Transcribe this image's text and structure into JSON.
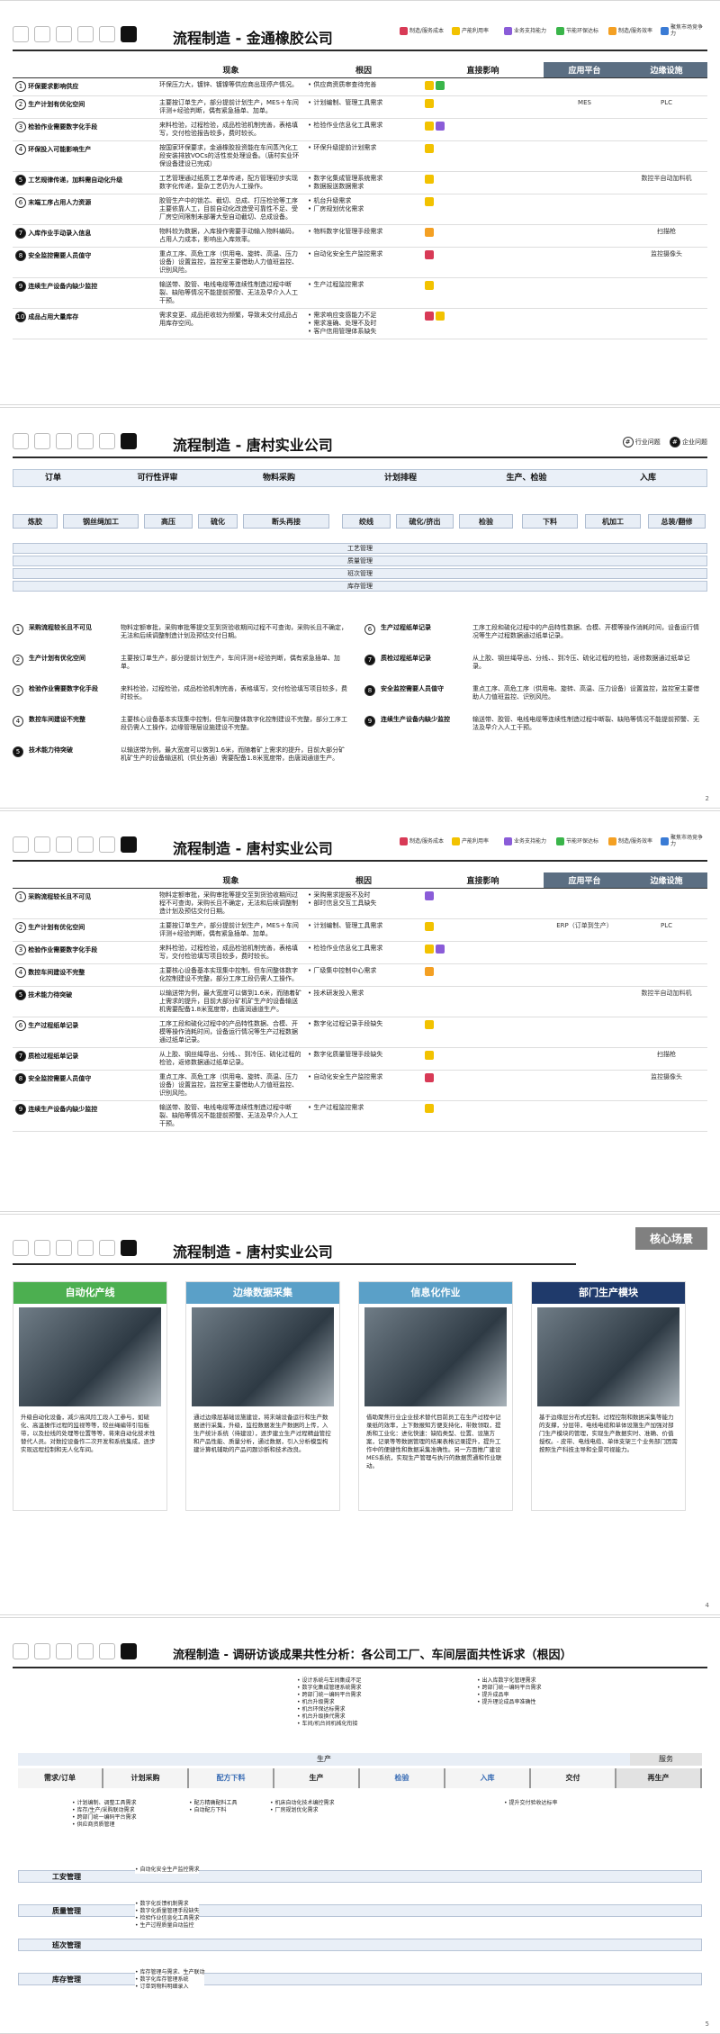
{
  "legend": [
    {
      "label": "制造/服务成本",
      "color": "#d83a56"
    },
    {
      "label": "产能利用率",
      "color": "#f2c200"
    },
    {
      "label": "业务支持能力",
      "color": "#8a5cd8"
    },
    {
      "label": "节能环保达标",
      "color": "#3ab54a"
    },
    {
      "label": "制造/服务效率",
      "color": "#f4a023"
    },
    {
      "label": "聚焦市场竞争力",
      "color": "#3a7bd5"
    }
  ],
  "slide1": {
    "title": "流程制造 - 金通橡胶公司",
    "headers": {
      "phenomenon": "现象",
      "root": "根因",
      "impact": "直接影响",
      "platform": "应用平台",
      "edge": "边缘设施"
    },
    "rows": [
      {
        "n": "1",
        "problem": "环保要求影响供应",
        "phen": "环保压力大，镀锌、镀镍等供应商出现停产情况。",
        "root": [
          "供应商资质审查待完善"
        ],
        "plat": "",
        "edge": ""
      },
      {
        "n": "2",
        "problem": "生产计划有优化空间",
        "phen": "主要按订单生产，部分提前计划生产，MES＋车间评测+经验判断，偶有紧急插单、加单。",
        "root": [
          "计划编制、管理工具需求"
        ],
        "plat": "MES",
        "edge": "PLC"
      },
      {
        "n": "3",
        "problem": "检验作业需要数字化手段",
        "phen": "来料检验，过程检验，成品检验机制完善，表格填写，交付检验报告较多，费时较长。",
        "root": [
          "检验作业信息化工具需求"
        ],
        "plat": "",
        "edge": ""
      },
      {
        "n": "4",
        "problem": "环保投入可能影响生产",
        "phen": "按国家环保要求，金通橡胶投资能在车间蒸汽化工段安装排放VOCs的活性炭处理设备。（唐村实业环保设备建设已完成）",
        "root": [
          "环保升级提前计划需求"
        ],
        "plat": "",
        "edge": ""
      },
      {
        "n": "5",
        "problem": "工艺规律传递，加料需自动化升级",
        "phen": "工艺管理通过纸质工艺单传递，配方管理初步实现数字化传递，复杂工艺仍为人工操作。",
        "root": [
          "数字化集成管理系统需求",
          "数据报送数据需求"
        ],
        "plat": "",
        "edge": "数控半自动加料机"
      },
      {
        "n": "6",
        "problem": "末端工序占用人力资源",
        "phen": "胶管生产中的锁芯、截切、总成、打压检验等工序主要依靠人工，目前自动化改造受可靠性不足、受厂房空间限制未部署大型自动截切、总成设备。",
        "root": [
          "机台升级需求",
          "厂房规划优化需求"
        ],
        "plat": "",
        "edge": ""
      },
      {
        "n": "7",
        "problem": "入库作业手动录入信息",
        "phen": "物料较为数据，入库操作需要手动输入物料编码，占用人力成本，影响出入库效率。",
        "root": [
          "物料数字化管理手段需求"
        ],
        "plat": "",
        "edge": "扫描枪"
      },
      {
        "n": "8",
        "problem": "安全监控需要人员值守",
        "phen": "重点工序、高危工序（供用电、旋转、高温、压力设备）设置监控，监控室主要借助人力值班监控、识别风险。",
        "root": [
          "自动化安全生产监控需求"
        ],
        "plat": "",
        "edge": "监控摄像头"
      },
      {
        "n": "9",
        "problem": "连续生产设备内缺少监控",
        "phen": "输送带、胶管、电线电缆等连续性制造过程中断裂、缺陷等情况不能提前预警、无法及早介入人工干预。",
        "root": [
          "生产过程监控需求"
        ],
        "plat": "",
        "edge": ""
      },
      {
        "n": "10",
        "problem": "成品占用大量库存",
        "phen": "需求变更、成品拒收较为频繁，导致未交付成品占用库存空间。",
        "root": [
          "需求响应变感能力不足",
          "需求准确、处理不及时",
          "客户信用管理体系缺失"
        ],
        "plat": "",
        "edge": ""
      }
    ]
  },
  "slide2": {
    "title": "流程制造 - 唐村实业公司",
    "tags": [
      "行业问题",
      "企业问题"
    ],
    "stages": [
      "订单",
      "可行性评审",
      "物料采购",
      "计划排程",
      "生产、检验",
      "入库"
    ],
    "substeps": [
      "炼胶",
      "钢丝绳加工",
      "高压",
      "硫化",
      "断头再接",
      "绞线",
      "硫化/挤出",
      "检验",
      "下料",
      "机加工",
      "总装/翻修"
    ],
    "lanes": [
      "工艺管理",
      "质量管理",
      "班次管理",
      "库存管理"
    ],
    "items": [
      {
        "n": "1",
        "t": "采购流程较长且不可见",
        "d": "物料定额审批，采购审批等提交至到货验收期间过程不可查询，采购长且不确定，无法和后续调整制造计划及预估交付日期。"
      },
      {
        "n": "2",
        "t": "生产计划有优化空间",
        "d": "主要按订单生产，部分提前计划生产，车间评测+经验判断，偶有紧急插单、加单。"
      },
      {
        "n": "3",
        "t": "检验作业需要数字化手段",
        "d": "来料检验，过程检验，成品检验机制完善，表格填写，交付检验填写项目较多，费时较长。"
      },
      {
        "n": "4",
        "t": "数控车间建设不完整",
        "d": "主要核心设备基本实现集中控制，但车间整体数字化控制建设不完整，部分工序工段仍需人工操作，边缘管理层设施建设不完整。"
      },
      {
        "n": "5",
        "t": "技术能力待突破",
        "d": "以输送带为例，最大宽度可以做到1.6米，而随着矿上需求的提升，目前大部分矿机矿生产的设备输送机（供业务通）需要配备1.8米宽度带，由唐润通道生产。"
      },
      {
        "n": "6",
        "t": "生产过程纸单记录",
        "d": "工序工段和硫化过程中的产品特性数据、合模、开模等操作消耗时间，设备运行情况等生产过程数据通过纸单记录。"
      },
      {
        "n": "7",
        "t": "质检过程纸单记录",
        "d": "从上胶、钢丝绳导出、分线、、到冷压、硫化过程的检验，返修数据通过纸单记录。"
      },
      {
        "n": "8",
        "t": "安全监控需要人员值守",
        "d": "重点工序、高危工序（供用电、旋转、高温、压力设备）设置监控，监控室主要借助人力值班监控、识别风险。"
      },
      {
        "n": "9",
        "t": "连续生产设备内缺少监控",
        "d": "输送带、胶管、电线电缆等连续性制造过程中断裂、缺陷等情况不能提前预警、无法及早介入人工干预。"
      }
    ],
    "page": "2"
  },
  "slide3": {
    "title": "流程制造 - 唐村实业公司",
    "headers": {
      "phenomenon": "现象",
      "root": "根因",
      "impact": "直接影响",
      "platform": "应用平台",
      "edge": "边缘设施"
    },
    "rows": [
      {
        "n": "1",
        "problem": "采购流程较长且不可见",
        "phen": "物料定额审批，采购审批等提交至到货验收期间过程不可查询，采购长且不确定，无法和后续调整制造计划及预估交付日期。",
        "root": [
          "采购需求提报不及时",
          "部时信息交互工具缺失"
        ],
        "plat": "",
        "edge": ""
      },
      {
        "n": "2",
        "problem": "生产计划有优化空间",
        "phen": "主要按订单生产，部分提前计划生产，MES＋车间评测+经验判断，偶有紧急插单、加单。",
        "root": [
          "计划编制、管理工具需求"
        ],
        "plat": "ERP（订单到生产）",
        "edge": "PLC"
      },
      {
        "n": "3",
        "problem": "检验作业需要数字化手段",
        "phen": "来料检验，过程检验，成品检验机制完善，表格填写，交付检验填写项目较多，费时较长。",
        "root": [
          "检验作业信息化工具需求"
        ],
        "plat": "",
        "edge": ""
      },
      {
        "n": "4",
        "problem": "数控车间建设不完整",
        "phen": "主要核心设备基本实现集中控制，但车间整体数字化控制建设不完整，部分工序工段仍需人工操作。",
        "root": [
          "厂级集中控制中心需求"
        ],
        "plat": "",
        "edge": ""
      },
      {
        "n": "5",
        "problem": "技术能力待突破",
        "phen": "以输送带为例，最大宽度可以做到1.6米，而随着矿上需求的提升，目前大部分矿机矿生产的设备输送机需要配备1.8米宽度带，由唐润通道生产。",
        "root": [
          "技术研发投入需求"
        ],
        "plat": "",
        "edge": "数控半自动加料机"
      },
      {
        "n": "6",
        "problem": "生产过程纸单记录",
        "phen": "工序工段和硫化过程中的产品特性数据、合模、开模等操作消耗时间，设备运行情况等生产过程数据通过纸单记录。",
        "root": [
          "数字化过程记录手段缺失"
        ],
        "plat": "",
        "edge": ""
      },
      {
        "n": "7",
        "problem": "质检过程纸单记录",
        "phen": "从上胶、钢丝绳导出、分线、、到冷压、硫化过程的检验，返修数据通过纸单记录。",
        "root": [
          "数字化质量管理手段缺失"
        ],
        "plat": "",
        "edge": "扫描枪"
      },
      {
        "n": "8",
        "problem": "安全监控需要人员值守",
        "phen": "重点工序、高危工序（供用电、旋转、高温、压力设备）设置监控，监控室主要借助人力值班监控、识别风险。",
        "root": [
          "自动化安全生产监控需求"
        ],
        "plat": "",
        "edge": "监控摄像头"
      },
      {
        "n": "9",
        "problem": "连续生产设备内缺少监控",
        "phen": "输送带、胶管、电线电缆等连续性制造过程中断裂、缺陷等情况不能提前预警、无法及早介入人工干预。",
        "root": [
          "生产过程监控需求"
        ],
        "plat": "",
        "edge": ""
      }
    ]
  },
  "slide4": {
    "title": "流程制造 - 唐村实业公司",
    "core": "核心场景",
    "cards": [
      {
        "title": "自动化产线",
        "color": "#4caf50",
        "text": "升级自动化设备，减少高风险工段人工参与，如硫化、高温操作过程的监视等等，较丝绳编带引铅板带，以及拉线的处理等位置等等，将来自动化技术性替代人员。对数控设备作二次开发和系统集成，逐步实现远程控制和无人化车间。"
      },
      {
        "title": "边缘数据采集",
        "color": "#5aa0c8",
        "text": "通过边缘层基础设施建设，将末端设备运行和生产数据进行采集，升级，监控数据发生产数据的上传，入生产统计系统（待建设），逐步建立生产过程精益管控和产品性能、质量分析，通过数据，引入分析模型构建计算机辅助的产品问题诊断和技术改良。"
      },
      {
        "title": "信息化作业",
        "color": "#5aa0c8",
        "text": "借助聚焦行业企业技术替代目前员工在生产过程中记录纸的效率，上下数报知方便支持化，带数领取，提质和工业化：进化快速：缺陷类型、位置、设施方案，记录等等数据管理的结果表格记录提升，提升工作中的便捷性和数据采集准确性。另一方面推广建设MES系统，实现生产管理与执行的数据贯通和作业联动。"
      },
      {
        "title": "部门生产模块",
        "color": "#1f3a6b",
        "text": "基于边缘层分布式控制，过程控制和数据采集等能力的支撑，分层带，电线电缆和单体设施生产加强对部门生产模块的管理，实现生产数据实时、准确、价值授权。- 皮带、电线电缆、单体支架三个业务部门因需按照生产科技主导和全景可视能力。"
      }
    ],
    "page": "4"
  },
  "slide5": {
    "title": "流程制造 - 调研访谈成果共性分析：各公司工厂、车间层面共性诉求（根因）",
    "bands": [
      "生产",
      "服务"
    ],
    "steps": [
      "需求/订单",
      "计划采购",
      "配方下料",
      "生产",
      "检验",
      "入库",
      "交付",
      "再生产"
    ],
    "top_left": [
      "设计系统与车间集成不足",
      "数字化集成管理系统需求",
      "跨部门统一编码平台需求",
      "机台升级需求",
      "机台环保达标需求",
      "机台升级换代需求",
      "车间/机台间机械化衔接"
    ],
    "top_right": [
      "出入库数字化管理需求",
      "跨部门统一编码平台需求",
      "提升成品率",
      "提升理论成品率准确性"
    ],
    "mid_a": [
      "计划编制、调整工具需求",
      "库存/生产/采购联动需求",
      "跨部门统一编码平台需求",
      "供应商资质管理"
    ],
    "mid_b": [
      "配方精确配料工具",
      "自动配方下料"
    ],
    "mid_c": [
      "机床自动化技术编控需求",
      "厂房规划优化需求"
    ],
    "mid_d": [
      "提升交付验收达标率"
    ],
    "lanes": [
      {
        "name": "工安管理",
        "items": [
          "自动化安全生产监控需求"
        ]
      },
      {
        "name": "质量管理",
        "items": [
          "数字化反馈机制需求",
          "数字化质量管理手段缺失",
          "检验作业信息化工具需求",
          "生产过程质量自动监控"
        ]
      },
      {
        "name": "班次管理",
        "items": []
      },
      {
        "name": "库存管理",
        "items": [
          "库存管理与需求、生产联动",
          "数字化库存管理系统",
          "订单到物料明细录入"
        ]
      }
    ],
    "page": "5"
  }
}
